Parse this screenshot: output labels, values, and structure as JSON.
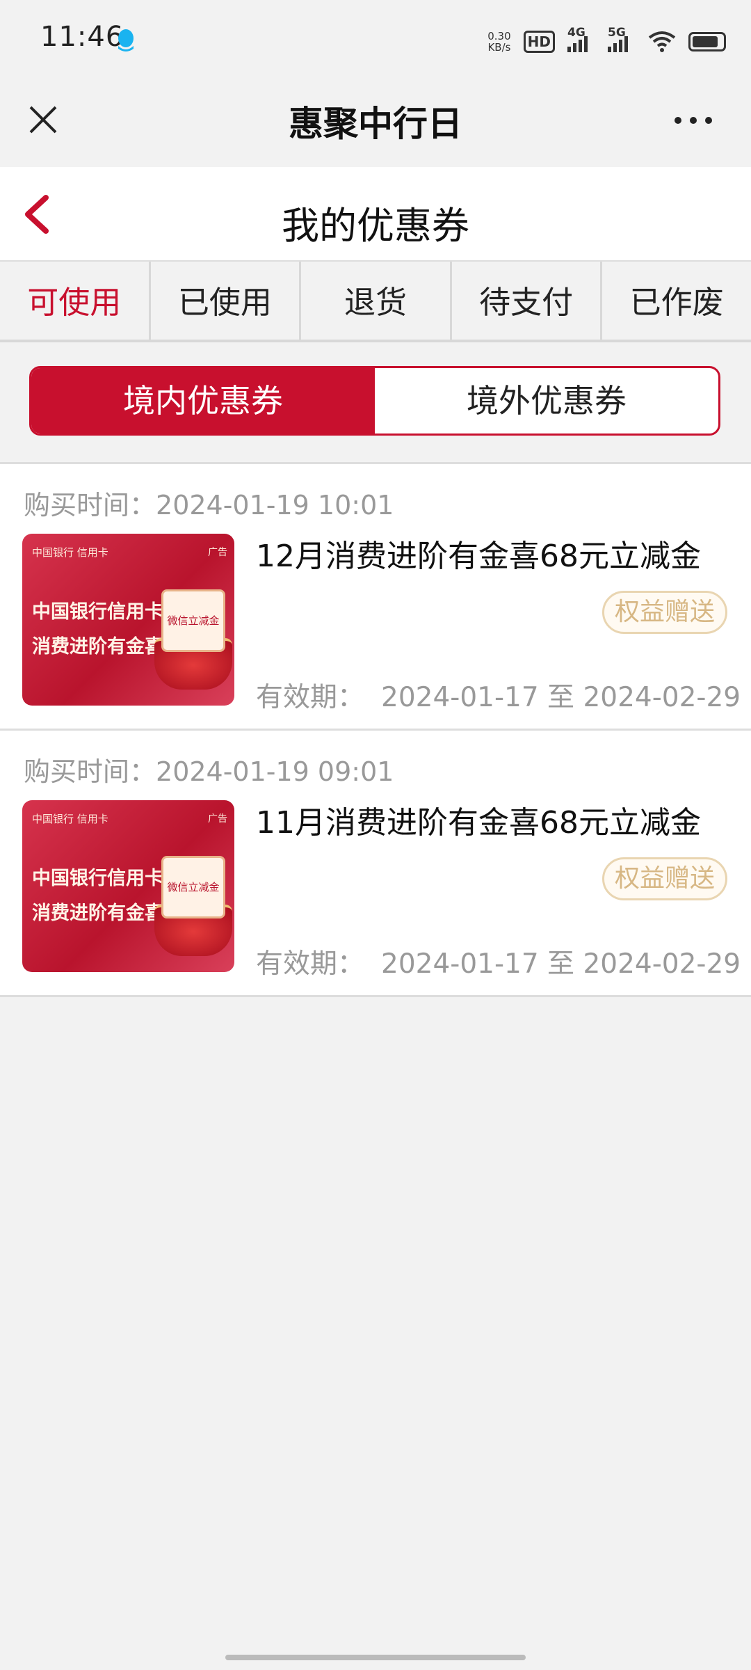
{
  "status_bar": {
    "time": "11:46",
    "speed_value": "0.30",
    "speed_unit": "KB/s",
    "hd": "HD",
    "net1": "4G",
    "net2": "5G"
  },
  "title_bar": {
    "title": "惠聚中行日"
  },
  "page_header": {
    "title": "我的优惠券"
  },
  "tabs": [
    {
      "label": "可使用",
      "active": true
    },
    {
      "label": "已使用",
      "active": false
    },
    {
      "label": "退货",
      "active": false
    },
    {
      "label": "待支付",
      "active": false
    },
    {
      "label": "已作废",
      "active": false
    }
  ],
  "segment": {
    "domestic": "境内优惠券",
    "overseas": "境外优惠券"
  },
  "coupon_thumb": {
    "logo": "中国银行 信用卡",
    "ad": "广告",
    "line1": "中国银行信用卡",
    "line2": "消费进阶有金喜",
    "box": "微信立减金"
  },
  "coupons": [
    {
      "purchase_label": "购买时间：",
      "purchase_time": "2024-01-19 10:01",
      "title": "12月消费进阶有金喜68元立减金",
      "gift_label": "权益赠送",
      "validity_label": "有效期：",
      "validity_range": "2024-01-17 至 2024-02-29"
    },
    {
      "purchase_label": "购买时间：",
      "purchase_time": "2024-01-19 09:01",
      "title": "11月消费进阶有金喜68元立减金",
      "gift_label": "权益赠送",
      "validity_label": "有效期：",
      "validity_range": "2024-01-17 至 2024-02-29"
    }
  ],
  "colors": {
    "accent": "#c8102e",
    "gift_text": "#d7b784",
    "muted": "#999999"
  }
}
